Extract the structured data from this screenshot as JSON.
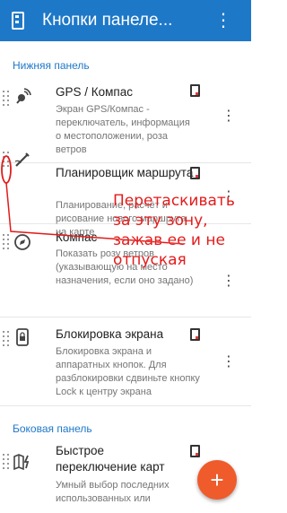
{
  "appbar": {
    "title": "Кнопки панеле..."
  },
  "sections": {
    "bottom": "Нижняя панель",
    "side": "Боковая панель"
  },
  "items": [
    {
      "title": "GPS / Компас",
      "desc": "Экран GPS/Компас - переключатель, информация о местоположении, роза ветров",
      "icon": "satellite-icon"
    },
    {
      "title": "Планировщик маршрута",
      "desc": "Планирование, расчёт и рисование нового маршрута на карте",
      "icon": "route-pen-icon"
    },
    {
      "title": "Компас",
      "desc": "Показать розу ветров (указывающую на место назначения, если оно задано)",
      "icon": "compass-icon"
    },
    {
      "title": "Блокировка экрана",
      "desc": "Блокировка экрана и аппаратных кнопок. Для разблокировки сдвиньте кнопку Lock к центру экрана",
      "icon": "lock-phone-icon"
    },
    {
      "title": "Быстрое переключение карт",
      "desc": "Умный выбор последних использованных или",
      "icon": "map-switch-icon"
    }
  ],
  "annotation": "Перетаскивать за эту зону, зажав ее и не отпуская",
  "fab": {
    "label": "+"
  },
  "colors": {
    "appbar": "#1e78c8",
    "accent": "#ef5b2b",
    "annotation": "#e31b1b"
  }
}
